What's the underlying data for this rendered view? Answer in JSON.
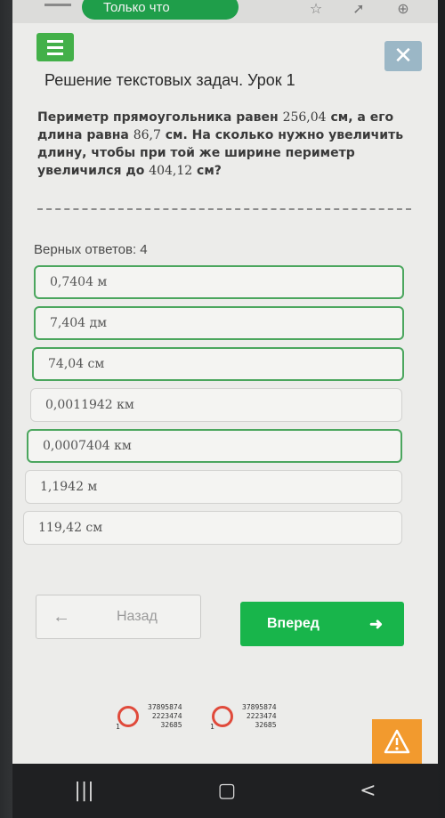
{
  "status": {
    "notification": "Только что"
  },
  "lesson": {
    "title": "Решение текстовых задач. Урок 1"
  },
  "question": {
    "p1": "Периметр прямоугольника равен ",
    "n1": "256,04",
    "p2": " см, а его длина равна ",
    "n2": "86,7",
    "p3": " см. На сколько нужно увеличить длину, чтобы при той же ширине периметр увеличился до ",
    "n3": "404,12",
    "p4": " см?"
  },
  "answers": {
    "correct_label": "Верных ответов: 4",
    "options": [
      {
        "label": "0,7404 м",
        "selected": true
      },
      {
        "label": "7,404 дм",
        "selected": true
      },
      {
        "label": "74,04 см",
        "selected": true
      },
      {
        "label": "0,0011942 км",
        "selected": false
      },
      {
        "label": "0,0007404 км",
        "selected": true
      },
      {
        "label": "1,1942 м",
        "selected": false
      },
      {
        "label": "119,42 см",
        "selected": false
      }
    ]
  },
  "navigation": {
    "back_label": "Назад",
    "next_label": "Вперед"
  },
  "captcha": {
    "left": [
      "37895874",
      "2223474",
      "32685"
    ],
    "right": [
      "37895874",
      "2223474",
      "32685"
    ],
    "digit": "1"
  },
  "colors": {
    "accent_green": "#18b54b",
    "selected_border": "#4ba65e",
    "warning": "#f29a2e"
  }
}
